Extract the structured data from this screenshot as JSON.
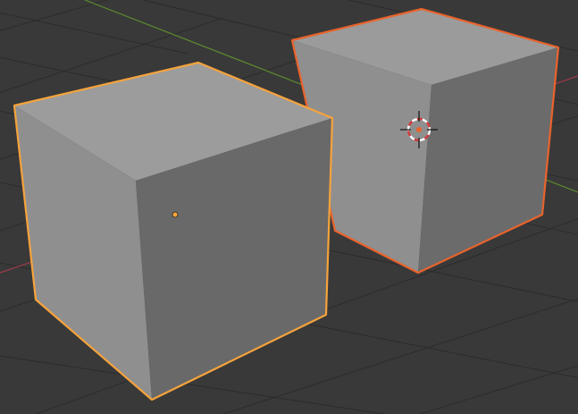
{
  "viewport": {
    "background_color": "#393939",
    "grid_color": "#2a2a2a",
    "axis_x_color": "#9a3b47",
    "axis_y_color": "#5d8a2f"
  },
  "objects": [
    {
      "name": "cube-left",
      "role": "active",
      "outline_color": "#f5a33c",
      "origin_color": "#f5a33c",
      "face_colors": {
        "top": "#9c9c9c",
        "left": "#8f8f8f",
        "right": "#6a6a6a"
      }
    },
    {
      "name": "cube-right",
      "role": "selected",
      "outline_color": "#e9632c",
      "face_colors": {
        "top": "#9a9a9a",
        "left": "#909090",
        "right": "#6b6b6b"
      }
    }
  ],
  "cursor": {
    "icon": "3d-cursor-icon",
    "ring_color_a": "#ffffff",
    "ring_color_b": "#d23b3b",
    "center_color": "#e9632c"
  }
}
